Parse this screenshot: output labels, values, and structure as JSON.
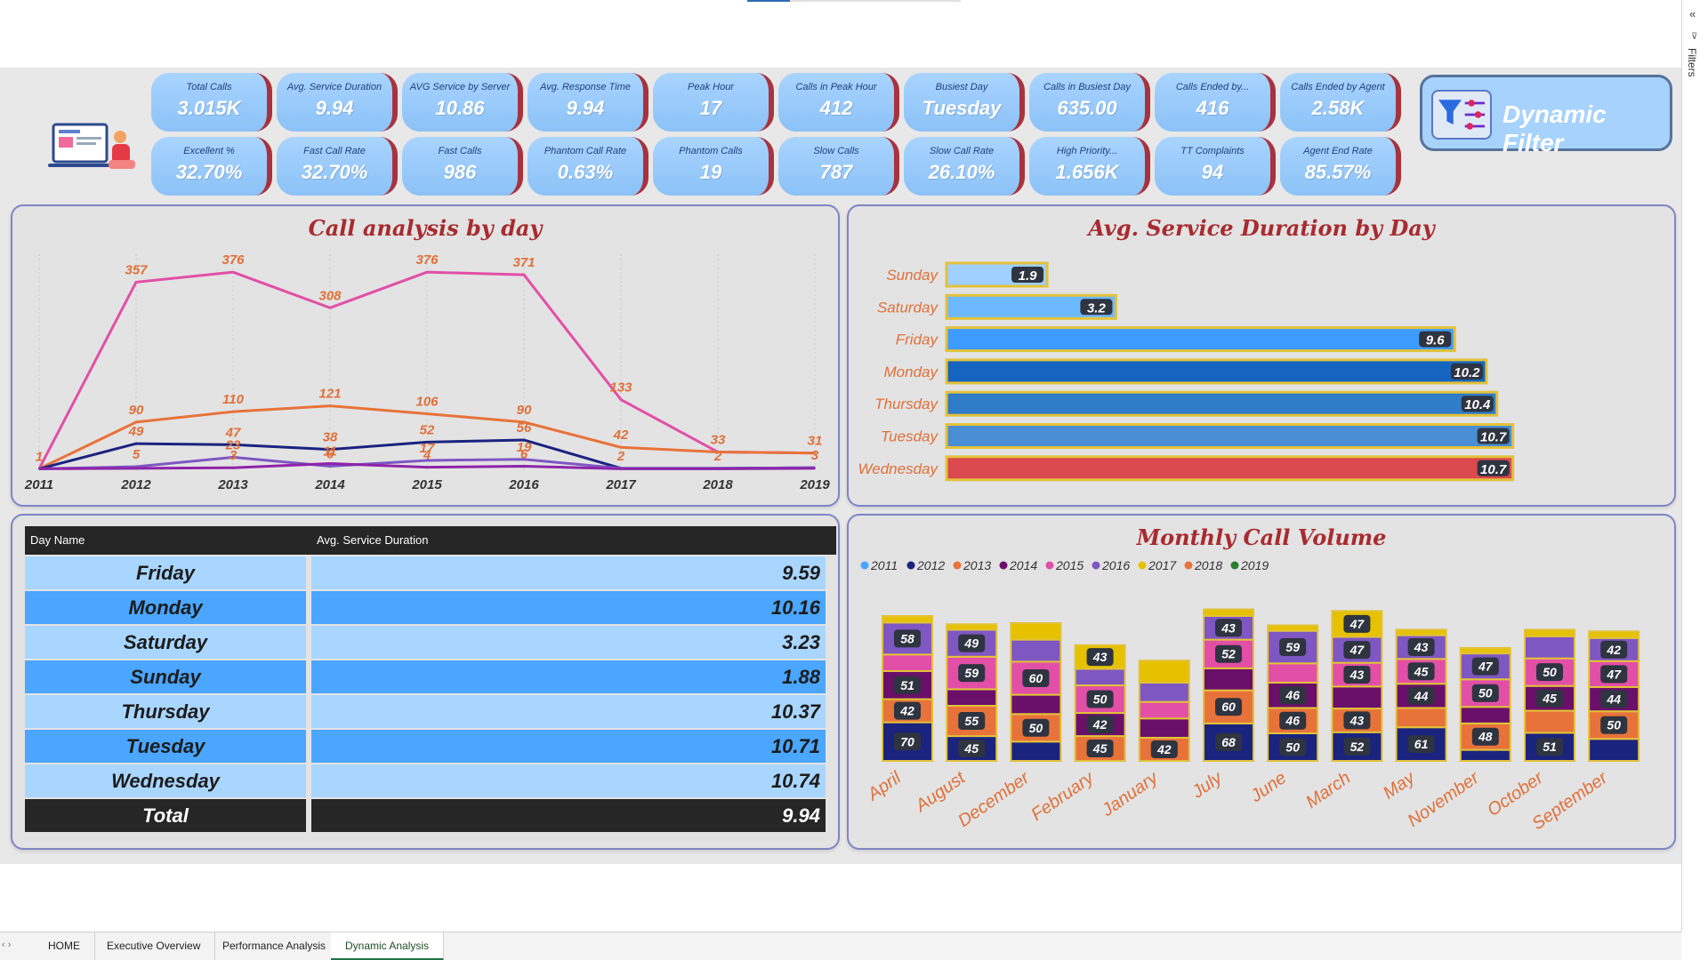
{
  "kpis": [
    {
      "label": "Total Calls",
      "value": "3.015K"
    },
    {
      "label": "Avg. Service Duration",
      "value": "9.94"
    },
    {
      "label": "AVG Service by Server",
      "value": "10.86"
    },
    {
      "label": "Avg. Response Time",
      "value": "9.94"
    },
    {
      "label": "Peak Hour",
      "value": "17"
    },
    {
      "label": "Calls in Peak Hour",
      "value": "412"
    },
    {
      "label": "Busiest Day",
      "value": "Tuesday"
    },
    {
      "label": "Calls in Busiest Day",
      "value": "635.00"
    },
    {
      "label": "Calls Ended by...",
      "value": "416"
    },
    {
      "label": "Calls Ended by Agent",
      "value": "2.58K"
    },
    {
      "label": "Excellent %",
      "value": "32.70%"
    },
    {
      "label": "Fast Call Rate",
      "value": "32.70%"
    },
    {
      "label": "Fast Calls",
      "value": "986"
    },
    {
      "label": "Phantom Call Rate",
      "value": "0.63%"
    },
    {
      "label": "Phantom Calls",
      "value": "19"
    },
    {
      "label": "Slow Calls",
      "value": "787"
    },
    {
      "label": "Slow Call Rate",
      "value": "26.10%"
    },
    {
      "label": "High Priority...",
      "value": "1.656K"
    },
    {
      "label": "TT Complaints",
      "value": "94"
    },
    {
      "label": "Agent End Rate",
      "value": "85.57%"
    }
  ],
  "dynamic_filter": {
    "label": "Dynamic Filter",
    "icon": "filter-sliders-icon"
  },
  "panels": {
    "line_title": "Call analysis by day",
    "bar_title": "Avg. Service Duration by Day",
    "stack_title": "Monthly Call Volume"
  },
  "table": {
    "col1": "Day Name",
    "col2": "Avg. Service Duration",
    "rows": [
      {
        "day": "Friday",
        "value": "9.59"
      },
      {
        "day": "Monday",
        "value": "10.16"
      },
      {
        "day": "Saturday",
        "value": "3.23"
      },
      {
        "day": "Sunday",
        "value": "1.88"
      },
      {
        "day": "Thursday",
        "value": "10.37"
      },
      {
        "day": "Tuesday",
        "value": "10.71"
      },
      {
        "day": "Wednesday",
        "value": "10.74"
      }
    ],
    "total_label": "Total",
    "total_value": "9.94"
  },
  "sidebar": {
    "label": "Filters"
  },
  "tabs": [
    {
      "label": "HOME",
      "active": false
    },
    {
      "label": "Executive Overview",
      "active": false
    },
    {
      "label": "Performance Analysis",
      "active": false
    },
    {
      "label": "Dynamic Analysis",
      "active": true
    }
  ],
  "colors": {
    "accent_red": "#a82b2f",
    "kpi_blue": "#8cc2f7",
    "panel_border": "#7f85c5"
  },
  "chart_data": [
    {
      "type": "line",
      "title": "Call analysis by day",
      "x": [
        "2011",
        "2012",
        "2013",
        "2014",
        "2015",
        "2016",
        "2017",
        "2018",
        "2019"
      ],
      "series": [
        {
          "color": "#e24fa6",
          "values": [
            1,
            357,
            376,
            308,
            376,
            371,
            133,
            33,
            31
          ],
          "labels": [
            "1",
            "357",
            "376",
            "308",
            "376",
            "371",
            "133",
            "33",
            "31"
          ]
        },
        {
          "color": "#e8733a",
          "values": [
            1,
            90,
            110,
            121,
            106,
            90,
            42,
            33,
            31
          ],
          "labels": [
            "",
            "90",
            "110",
            "121",
            "106",
            "90",
            "42",
            "",
            ""
          ]
        },
        {
          "color": "#1a237e",
          "values": [
            1,
            49,
            47,
            38,
            52,
            56,
            2,
            2,
            3
          ],
          "labels": [
            "",
            "49",
            "47",
            "38",
            "52",
            "56",
            "2",
            "",
            "3"
          ]
        },
        {
          "color": "#7e57c2",
          "values": [
            1,
            5,
            23,
            6,
            17,
            19,
            2,
            2,
            3
          ],
          "labels": [
            "",
            "5",
            "23",
            "6",
            "17",
            "19",
            "",
            "2",
            ""
          ]
        },
        {
          "color": "#8e24aa",
          "values": [
            1,
            2,
            3,
            11,
            4,
            6,
            1,
            1,
            2
          ],
          "labels": [
            "",
            "",
            "3",
            "11",
            "4",
            "6",
            "",
            "",
            ""
          ]
        }
      ],
      "ylim": [
        0,
        400
      ]
    },
    {
      "type": "bar",
      "title": "Avg. Service Duration by Day",
      "categories": [
        "Sunday",
        "Saturday",
        "Friday",
        "Monday",
        "Thursday",
        "Tuesday",
        "Wednesday"
      ],
      "values": [
        1.9,
        3.2,
        9.6,
        10.2,
        10.4,
        10.7,
        10.7
      ],
      "colors": [
        "#9fd0ff",
        "#6db9ff",
        "#3d9bff",
        "#1565c0",
        "#2f7cc8",
        "#4a8ed3",
        "#d9494d"
      ],
      "xlim": [
        0,
        12
      ]
    },
    {
      "type": "bar",
      "title": "Monthly Call Volume",
      "legend": [
        "2011",
        "2012",
        "2013",
        "2014",
        "2015",
        "2016",
        "2017",
        "2018",
        "2019"
      ],
      "legend_colors": [
        "#4aa6ff",
        "#1a237e",
        "#e8733a",
        "#6a0f6a",
        "#e24fa6",
        "#7e57c2",
        "#e5c100",
        "#e8733a",
        "#2e7d32"
      ],
      "categories": [
        "April",
        "August",
        "December",
        "February",
        "January",
        "July",
        "June",
        "March",
        "May",
        "November",
        "October",
        "September"
      ],
      "stacks": [
        {
          "segments": [
            {
              "v": 70,
              "c": "#1a237e"
            },
            {
              "v": 42,
              "c": "#e8733a"
            },
            {
              "v": 51,
              "c": "#6a0f6a"
            },
            {
              "v": 30,
              "c": "#e24fa6"
            },
            {
              "v": 58,
              "c": "#7e57c2"
            },
            {
              "v": 12,
              "c": "#e5c100"
            }
          ],
          "labels": [
            "70",
            "42",
            "51",
            "",
            "58",
            ""
          ]
        },
        {
          "segments": [
            {
              "v": 45,
              "c": "#1a237e"
            },
            {
              "v": 55,
              "c": "#e8733a"
            },
            {
              "v": 30,
              "c": "#6a0f6a"
            },
            {
              "v": 59,
              "c": "#e24fa6"
            },
            {
              "v": 49,
              "c": "#7e57c2"
            },
            {
              "v": 10,
              "c": "#e5c100"
            }
          ],
          "labels": [
            "45",
            "55",
            "",
            "59",
            "49",
            ""
          ]
        },
        {
          "segments": [
            {
              "v": 35,
              "c": "#1a237e"
            },
            {
              "v": 50,
              "c": "#e8733a"
            },
            {
              "v": 35,
              "c": "#6a0f6a"
            },
            {
              "v": 60,
              "c": "#e24fa6"
            },
            {
              "v": 40,
              "c": "#7e57c2"
            },
            {
              "v": 30,
              "c": "#e5c100"
            }
          ],
          "labels": [
            "",
            "50",
            "",
            "60",
            "",
            ""
          ]
        },
        {
          "segments": [
            {
              "v": 45,
              "c": "#e8733a"
            },
            {
              "v": 42,
              "c": "#6a0f6a"
            },
            {
              "v": 50,
              "c": "#e24fa6"
            },
            {
              "v": 30,
              "c": "#7e57c2"
            },
            {
              "v": 43,
              "c": "#e5c100"
            }
          ],
          "labels": [
            "45",
            "42",
            "50",
            "",
            "43"
          ]
        },
        {
          "segments": [
            {
              "v": 42,
              "c": "#e8733a"
            },
            {
              "v": 35,
              "c": "#6a0f6a"
            },
            {
              "v": 30,
              "c": "#e24fa6"
            },
            {
              "v": 35,
              "c": "#7e57c2"
            },
            {
              "v": 40,
              "c": "#e5c100"
            }
          ],
          "labels": [
            "42",
            "",
            "",
            "",
            ""
          ]
        },
        {
          "segments": [
            {
              "v": 68,
              "c": "#1a237e"
            },
            {
              "v": 60,
              "c": "#e8733a"
            },
            {
              "v": 40,
              "c": "#6a0f6a"
            },
            {
              "v": 52,
              "c": "#e24fa6"
            },
            {
              "v": 43,
              "c": "#7e57c2"
            },
            {
              "v": 12,
              "c": "#e5c100"
            }
          ],
          "labels": [
            "68",
            "60",
            "",
            "52",
            "43",
            ""
          ]
        },
        {
          "segments": [
            {
              "v": 50,
              "c": "#1a237e"
            },
            {
              "v": 46,
              "c": "#e8733a"
            },
            {
              "v": 46,
              "c": "#6a0f6a"
            },
            {
              "v": 35,
              "c": "#e24fa6"
            },
            {
              "v": 59,
              "c": "#7e57c2"
            },
            {
              "v": 10,
              "c": "#e5c100"
            }
          ],
          "labels": [
            "50",
            "46",
            "46",
            "",
            "59",
            ""
          ]
        },
        {
          "segments": [
            {
              "v": 52,
              "c": "#1a237e"
            },
            {
              "v": 43,
              "c": "#e8733a"
            },
            {
              "v": 40,
              "c": "#6a0f6a"
            },
            {
              "v": 43,
              "c": "#e24fa6"
            },
            {
              "v": 47,
              "c": "#7e57c2"
            },
            {
              "v": 47,
              "c": "#e5c100"
            }
          ],
          "labels": [
            "52",
            "43",
            "",
            "43",
            "47",
            "47"
          ]
        },
        {
          "segments": [
            {
              "v": 61,
              "c": "#1a237e"
            },
            {
              "v": 35,
              "c": "#e8733a"
            },
            {
              "v": 44,
              "c": "#6a0f6a"
            },
            {
              "v": 45,
              "c": "#e24fa6"
            },
            {
              "v": 43,
              "c": "#7e57c2"
            },
            {
              "v": 10,
              "c": "#e5c100"
            }
          ],
          "labels": [
            "61",
            "",
            "44",
            "45",
            "43",
            ""
          ]
        },
        {
          "segments": [
            {
              "v": 20,
              "c": "#1a237e"
            },
            {
              "v": 48,
              "c": "#e8733a"
            },
            {
              "v": 30,
              "c": "#6a0f6a"
            },
            {
              "v": 50,
              "c": "#e24fa6"
            },
            {
              "v": 47,
              "c": "#7e57c2"
            },
            {
              "v": 10,
              "c": "#e5c100"
            }
          ],
          "labels": [
            "",
            "48",
            "",
            "50",
            "47",
            ""
          ]
        },
        {
          "segments": [
            {
              "v": 51,
              "c": "#1a237e"
            },
            {
              "v": 40,
              "c": "#e8733a"
            },
            {
              "v": 45,
              "c": "#6a0f6a"
            },
            {
              "v": 50,
              "c": "#e24fa6"
            },
            {
              "v": 40,
              "c": "#7e57c2"
            },
            {
              "v": 12,
              "c": "#e5c100"
            }
          ],
          "labels": [
            "51",
            "",
            "45",
            "50",
            "",
            ""
          ]
        },
        {
          "segments": [
            {
              "v": 40,
              "c": "#1a237e"
            },
            {
              "v": 50,
              "c": "#e8733a"
            },
            {
              "v": 44,
              "c": "#6a0f6a"
            },
            {
              "v": 47,
              "c": "#e24fa6"
            },
            {
              "v": 42,
              "c": "#7e57c2"
            },
            {
              "v": 12,
              "c": "#e5c100"
            }
          ],
          "labels": [
            "",
            "50",
            "44",
            "47",
            "42",
            ""
          ]
        }
      ]
    }
  ]
}
